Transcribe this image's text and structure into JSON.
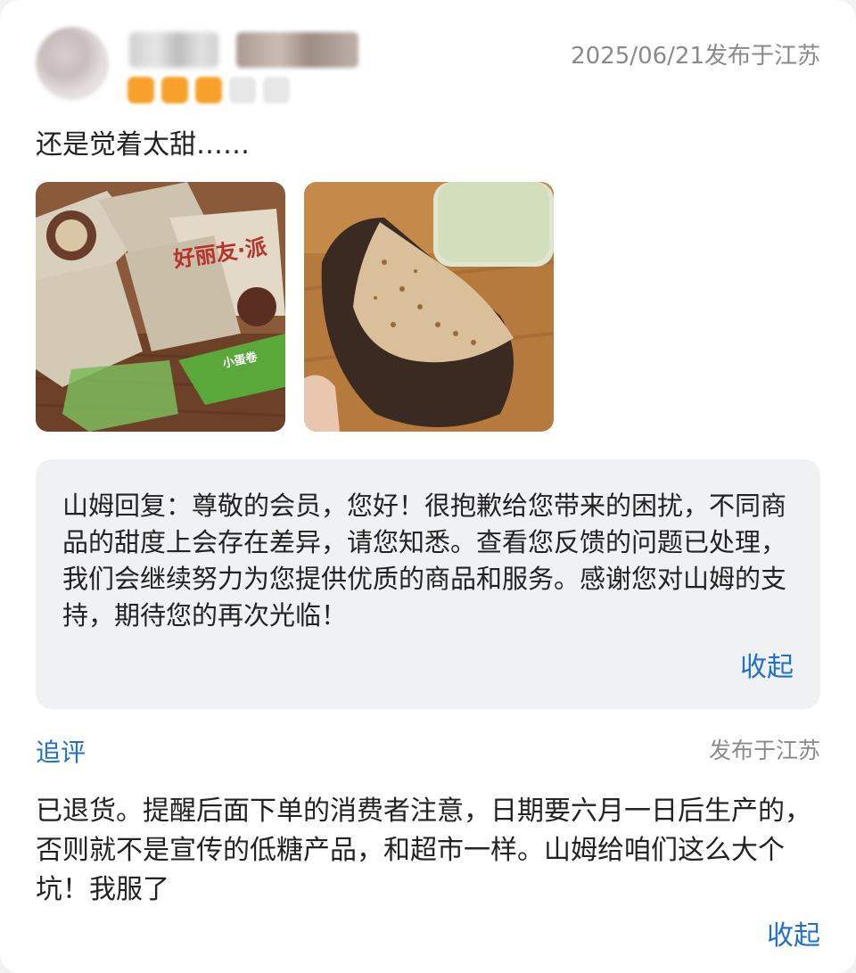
{
  "review": {
    "rating": 3,
    "max_rating": 5,
    "publish_info": "2025/06/21发布于江苏",
    "text": "还是觉着太甜……",
    "photos": [
      {
        "subject": "basket-of-snack-packs"
      },
      {
        "subject": "bitten-chocolate-cake"
      }
    ],
    "photo_text": {
      "pack_brand": "好丽友·派",
      "pack_green": "小蛋卷"
    }
  },
  "reply": {
    "text": "山姆回复：尊敬的会员，您好！很抱歉给您带来的困扰，不同商品的甜度上会存在差异，请您知悉。查看您反馈的问题已处理，我们会继续努力为您提供优质的商品和服务。感谢您对山姆的支持，期待您的再次光临！",
    "collapse_label": "收起"
  },
  "followup": {
    "label": "追评",
    "publish_info": "发布于江苏",
    "text": "已退货。提醒后面下单的消费者注意，日期要六月一日后生产的，否则就不是宣传的低糖产品，和超市一样。山姆给咱们这么大个坑！我服了",
    "collapse_label": "收起"
  },
  "colors": {
    "accent": "#1f6fd1",
    "star_on": "#f7a12c",
    "star_off": "#e7e7e7",
    "reply_bg": "#f0f1f3"
  }
}
